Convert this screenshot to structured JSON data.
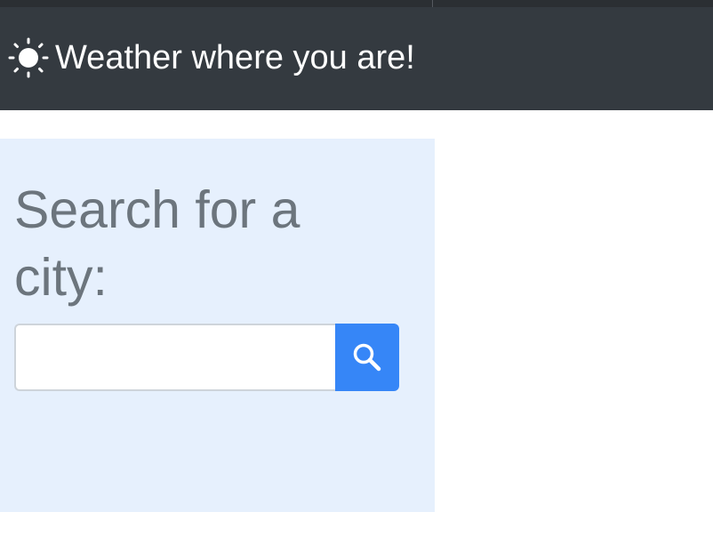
{
  "navbar": {
    "brand_icon": "sun-icon",
    "brand_text": "Weather where you are!",
    "background_color": "#343a40"
  },
  "search": {
    "heading": "Search for a city:",
    "input_value": "",
    "input_placeholder": "",
    "button_icon": "search-icon",
    "button_color": "#3686f7",
    "panel_color": "#e6f0fd"
  }
}
